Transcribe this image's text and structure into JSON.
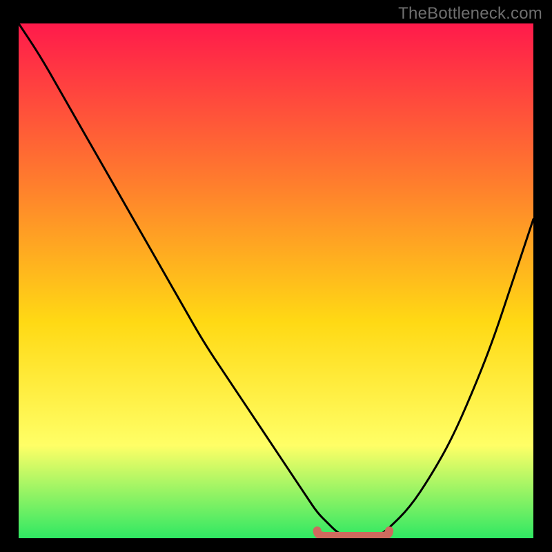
{
  "watermark": "TheBottleneck.com",
  "colors": {
    "background": "#000000",
    "gradient_top": "#ff1a4b",
    "gradient_mid1": "#ff7a2e",
    "gradient_mid2": "#ffd914",
    "gradient_mid3": "#ffff66",
    "gradient_bottom": "#2fe863",
    "curve": "#000000",
    "marker": "#cf6a5e"
  },
  "chart_data": {
    "type": "line",
    "title": "",
    "xlabel": "",
    "ylabel": "",
    "xlim": [
      0,
      100
    ],
    "ylim": [
      0,
      100
    ],
    "x": [
      0,
      4,
      8,
      12,
      16,
      20,
      24,
      28,
      32,
      36,
      40,
      44,
      48,
      52,
      56,
      58,
      60,
      62,
      64,
      66,
      68,
      70,
      72,
      76,
      80,
      84,
      88,
      92,
      96,
      100
    ],
    "values": [
      100,
      94,
      87,
      80,
      73,
      66,
      59,
      52,
      45,
      38,
      32,
      26,
      20,
      14,
      8,
      5,
      3,
      1,
      0.3,
      0,
      0,
      0.5,
      2,
      6,
      12,
      19,
      28,
      38,
      50,
      62
    ],
    "marker_segment": {
      "x_start": 58,
      "x_end": 72,
      "y": 0.4
    },
    "annotations": []
  }
}
